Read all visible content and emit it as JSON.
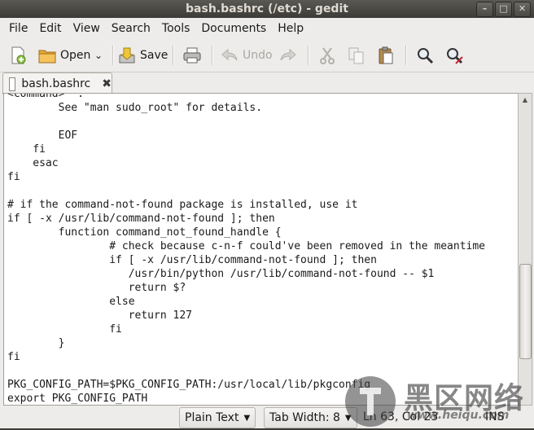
{
  "window": {
    "title": "bash.bashrc (/etc) - gedit"
  },
  "menu": [
    "File",
    "Edit",
    "View",
    "Search",
    "Tools",
    "Documents",
    "Help"
  ],
  "toolbar": {
    "open_label": "Open",
    "save_label": "Save",
    "undo_label": "Undo"
  },
  "tab": {
    "label": "bash.bashrc"
  },
  "editor": {
    "lines": [
      "<command>' :",
      "        See \"man sudo_root\" for details.",
      "",
      "        EOF",
      "    fi",
      "    esac",
      "fi",
      "",
      "# if the command-not-found package is installed, use it",
      "if [ -x /usr/lib/command-not-found ]; then",
      "        function command_not_found_handle {",
      "                # check because c-n-f could've been removed in the meantime",
      "                if [ -x /usr/lib/command-not-found ]; then",
      "                   /usr/bin/python /usr/lib/command-not-found -- $1",
      "                   return $?",
      "                else",
      "                   return 127",
      "                fi",
      "        }",
      "fi",
      "",
      "PKG_CONFIG_PATH=$PKG_CONFIG_PATH:/usr/local/lib/pkgconfig",
      "export PKG_CONFIG_PATH"
    ],
    "scroll_position": 0.82
  },
  "status": {
    "language": "Plain Text",
    "tab_width": "Tab Width: 8",
    "position": "Ln 63, Col 23",
    "mode": "INS"
  },
  "watermark": {
    "cn": "黑区网络",
    "url": "www.heiqu.com"
  }
}
